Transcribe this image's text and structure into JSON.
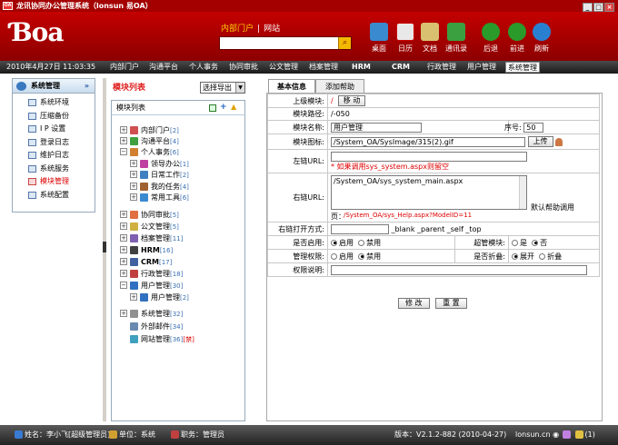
{
  "window": {
    "title": "龙讯协同办公管理系统（lonsun 易OA）",
    "app_icon": "OA"
  },
  "header": {
    "logo": "Ɓoa",
    "nav_links": [
      "内部门户",
      "网站"
    ],
    "nav_sep": "|",
    "toolbar": [
      "桌面",
      "日历",
      "文档",
      "通讯录",
      "后退",
      "前进",
      "刷新"
    ]
  },
  "menubar": {
    "datetime": "2010年4月27日 11:03:35",
    "items": [
      "内部门户",
      "沟通平台",
      "个人事务",
      "协同审批",
      "公文管理",
      "档案管理",
      "HRM",
      "CRM",
      "行政管理",
      "用户管理",
      "系统管理"
    ],
    "active": "系统管理"
  },
  "left_panel": {
    "title": "系统管理",
    "toggle": "»",
    "items": [
      "系统环境",
      "压缩备份",
      "I P 设置",
      "登录日志",
      "维护日志",
      "系统服务",
      "模块管理",
      "系统配置"
    ],
    "active": "模块管理"
  },
  "module": {
    "title": "模块列表",
    "export_select": "选择导出",
    "tree_title": "模块列表",
    "tree": [
      {
        "label": "内部门户",
        "count": "[2]"
      },
      {
        "label": "沟通平台",
        "count": "[4]"
      },
      {
        "label": "个人事务",
        "count": "[6]"
      },
      {
        "label": "领导办公",
        "count": "[1]"
      },
      {
        "label": "日常工作",
        "count": "[2]"
      },
      {
        "label": "我的任务",
        "count": "[4]"
      },
      {
        "label": "常用工具",
        "count": "[6]"
      },
      {
        "label": "协同审批",
        "count": "[5]"
      },
      {
        "label": "公文管理",
        "count": "[5]"
      },
      {
        "label": "档案管理",
        "count": "[11]"
      },
      {
        "label": "HRM",
        "count": "[16]"
      },
      {
        "label": "CRM",
        "count": "[17]"
      },
      {
        "label": "行政管理",
        "count": "[18]"
      },
      {
        "label": "用户管理",
        "count": "[30]"
      },
      {
        "label": "用户管理",
        "count": "[2]"
      },
      {
        "label": "系统管理",
        "count": "[32]"
      },
      {
        "label": "外部邮件",
        "count": "[34]"
      },
      {
        "label": "网站管理",
        "count": "[36]",
        "extra": "[禁]"
      }
    ]
  },
  "tabs": [
    "基本信息",
    "添加帮助"
  ],
  "form": {
    "parent_label": "上级模块:",
    "parent_value": "/",
    "move_button": "移  动",
    "path_label": "模块路径:",
    "path_value": "/-050",
    "name_label": "模块名称:",
    "name_value": "用户管理",
    "order_label": "序号:",
    "order_value": "50",
    "icon_label": "模块图标:",
    "icon_value": "/System_OA/SysImage/315(2).gif",
    "upload_button": "上传",
    "leftlink_label": "左链URL:",
    "leftlink_value": "",
    "leftlink_hint": "* 如果调用sys_system.aspx则留空",
    "rightlink_label": "右链URL:",
    "rightlink_value": "/System_OA/sys_system_main.aspx",
    "default_help": "默认帮助调用",
    "help_prefix": "页：",
    "help_value": "/System_OA/sys_Help.aspx?ModelID=11",
    "target_label": "右链打开方式:",
    "target_value": "",
    "target_hint": "_blank _parent _self _top",
    "enable_label": "是否启用:",
    "enable_options": [
      "启用",
      "禁用"
    ],
    "super_label": "超管模块:",
    "super_options": [
      "是",
      "否"
    ],
    "perm_label": "管理权限:",
    "perm_options": [
      "启用",
      "禁用"
    ],
    "fold_label": "是否折叠:",
    "fold_options": [
      "展开",
      "折叠"
    ],
    "permdesc_label": "权限说明:",
    "permdesc_value": "",
    "modify_button": "修  改",
    "reset_button": "重  置"
  },
  "status": {
    "user": "姓名：李小飞[超级管理员]",
    "unit": "单位：系统",
    "position": "职务：管理员",
    "version": "版本：V2.1.2-882 (2010-04-27)",
    "site": "lonsun.cn",
    "count": "(1)"
  }
}
